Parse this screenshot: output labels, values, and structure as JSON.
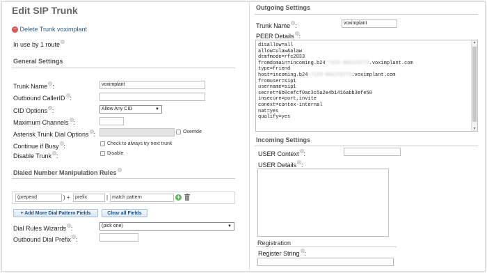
{
  "left": {
    "title": "Edit SIP Trunk",
    "delete_link": "Delete Trunk voximplant",
    "in_use": "In use by 1 route",
    "general": {
      "header": "General Settings",
      "trunk_name_label": "Trunk Name",
      "trunk_name_value": "voximplant",
      "callerid_label": "Outbound CallerID",
      "callerid_value": "",
      "cid_options_label": "CID Options",
      "cid_options_value": "Allow Any CID",
      "max_channels_label": "Maximum Channels",
      "max_channels_value": "",
      "dial_options_label": "Asterisk Trunk Dial Options",
      "dial_options_value": "",
      "override_label": "Override",
      "continue_busy_label": "Continue if Busy",
      "continue_busy_text": "Check to always try next trunk",
      "disable_label": "Disable Trunk",
      "disable_text": "Disable"
    },
    "dialed": {
      "header": "Dialed Number Manipulation Rules",
      "prepend_placeholder": "(prepend",
      "plus_sign": ") +",
      "prefix_placeholder": "prefix",
      "pipe_sign": "|",
      "match_placeholder": "match pattern",
      "add_more_button": "+ Add More Dial Pattern Fields",
      "clear_button": "Clear all Fields",
      "wizards_label": "Dial Rules Wizards",
      "wizards_value": "(pick one)",
      "prefix_label": "Outbound Dial Prefix",
      "prefix_value": ""
    }
  },
  "right": {
    "outgoing_header": "Outgoing Settings",
    "trunk_name_label": "Trunk Name",
    "trunk_name_value": "voximplant",
    "peer_label": "PEER Details",
    "peer_lines": [
      {
        "text": "disallow=all"
      },
      {
        "text": "allow=ulaw&alaw"
      },
      {
        "text": "dtmfmode=rfc2833"
      },
      {
        "pre": "fromdomain=incoming.b24",
        "blur": "-7123-001223773",
        "post": ".voximplant.com"
      },
      {
        "text": "type=friend"
      },
      {
        "pre": "host=incoming.b24",
        "blur": "-7123-001223773",
        "post": ".voximplant.com"
      },
      {
        "text": "fromuser=sip1"
      },
      {
        "text": "username=sip1"
      },
      {
        "text": "secret=6b0cefcf0ac3c5a2e4b1416abb3efe50"
      },
      {
        "text": "insecure=port,invite"
      },
      {
        "text": "conext=contex-internal"
      },
      {
        "text": "nat=yes"
      },
      {
        "text": "qualify=yes"
      }
    ],
    "incoming_header": "Incoming Settings",
    "user_context_label": "USER Context",
    "user_context_value": "",
    "user_details_label": "USER Details",
    "registration_header": "Registration",
    "register_label": "Register String",
    "register_value": ""
  },
  "colors": {
    "link": "#2f5a8a",
    "button_text": "#1d4f83",
    "delete_icon": "#d9534f",
    "add_icon": "#5cb85c"
  }
}
